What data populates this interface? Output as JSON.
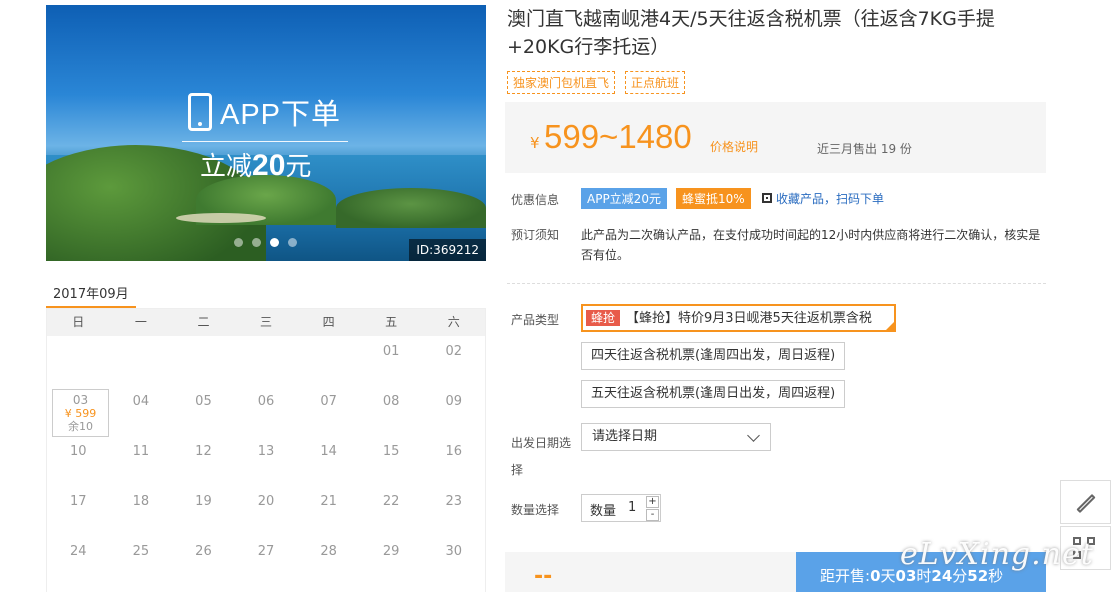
{
  "banner": {
    "app_text": "APP下单",
    "promo_prefix": "立减",
    "promo_amount": "20",
    "promo_suffix": "元",
    "id_label": "ID:369212",
    "slide_count": 4,
    "active_slide": 3
  },
  "calendar": {
    "month": "2017年09月",
    "weekdays": [
      "日",
      "一",
      "二",
      "三",
      "四",
      "五",
      "六"
    ],
    "weeks": [
      [
        "",
        "",
        "",
        "",
        "",
        "01",
        "02"
      ],
      [
        "03",
        "04",
        "05",
        "06",
        "07",
        "08",
        "09"
      ],
      [
        "10",
        "11",
        "12",
        "13",
        "14",
        "15",
        "16"
      ],
      [
        "17",
        "18",
        "19",
        "20",
        "21",
        "22",
        "23"
      ],
      [
        "24",
        "25",
        "26",
        "27",
        "28",
        "29",
        "30"
      ]
    ],
    "selected": {
      "day": "03",
      "price": "¥ 599",
      "remain": "余10"
    }
  },
  "product": {
    "title": "澳门直飞越南岘港4天/5天往返含税机票（往返含7KG手提+20KG行李托运）",
    "tags": [
      "独家澳门包机直飞",
      "正点航班"
    ],
    "currency": "¥",
    "price": "599~1480",
    "price_note": "价格说明",
    "sold": "近三月售出 19 份"
  },
  "promo": {
    "label": "优惠信息",
    "badge_app": "APP立减20元",
    "badge_bee": "蜂蜜抵10%",
    "collect": "收藏产品，扫码下单"
  },
  "notice": {
    "label": "预订须知",
    "text": "此产品为二次确认产品，在支付成功时间起的12小时内供应商将进行二次确认，核实是否有位。"
  },
  "types": {
    "label": "产品类型",
    "options": [
      {
        "tag": "蜂抢",
        "text": "【蜂抢】特价9月3日岘港5天往返机票含税",
        "active": true
      },
      {
        "text": "四天往返含税机票(逢周四出发，周日返程)"
      },
      {
        "text": "五天往返含税机票(逢周日出发，周四返程)"
      }
    ]
  },
  "date": {
    "label_line1": "出发日期选",
    "label_line2": "择",
    "placeholder": "请选择日期"
  },
  "quantity": {
    "label": "数量选择",
    "field_label": "数量",
    "value": "1",
    "plus": "+",
    "minus": "-"
  },
  "bottom": {
    "dashes": "--",
    "countdown_prefix": "距开售:",
    "days": "0",
    "days_unit": "天",
    "hours": "03",
    "hours_unit": "时",
    "minutes": "24",
    "minutes_unit": "分",
    "seconds": "52",
    "seconds_unit": "秒"
  },
  "watermark": "eLvXing.net",
  "colors": {
    "accent": "#f7931e",
    "blue": "#5aa2e8",
    "red_tag": "#e85b4a"
  }
}
